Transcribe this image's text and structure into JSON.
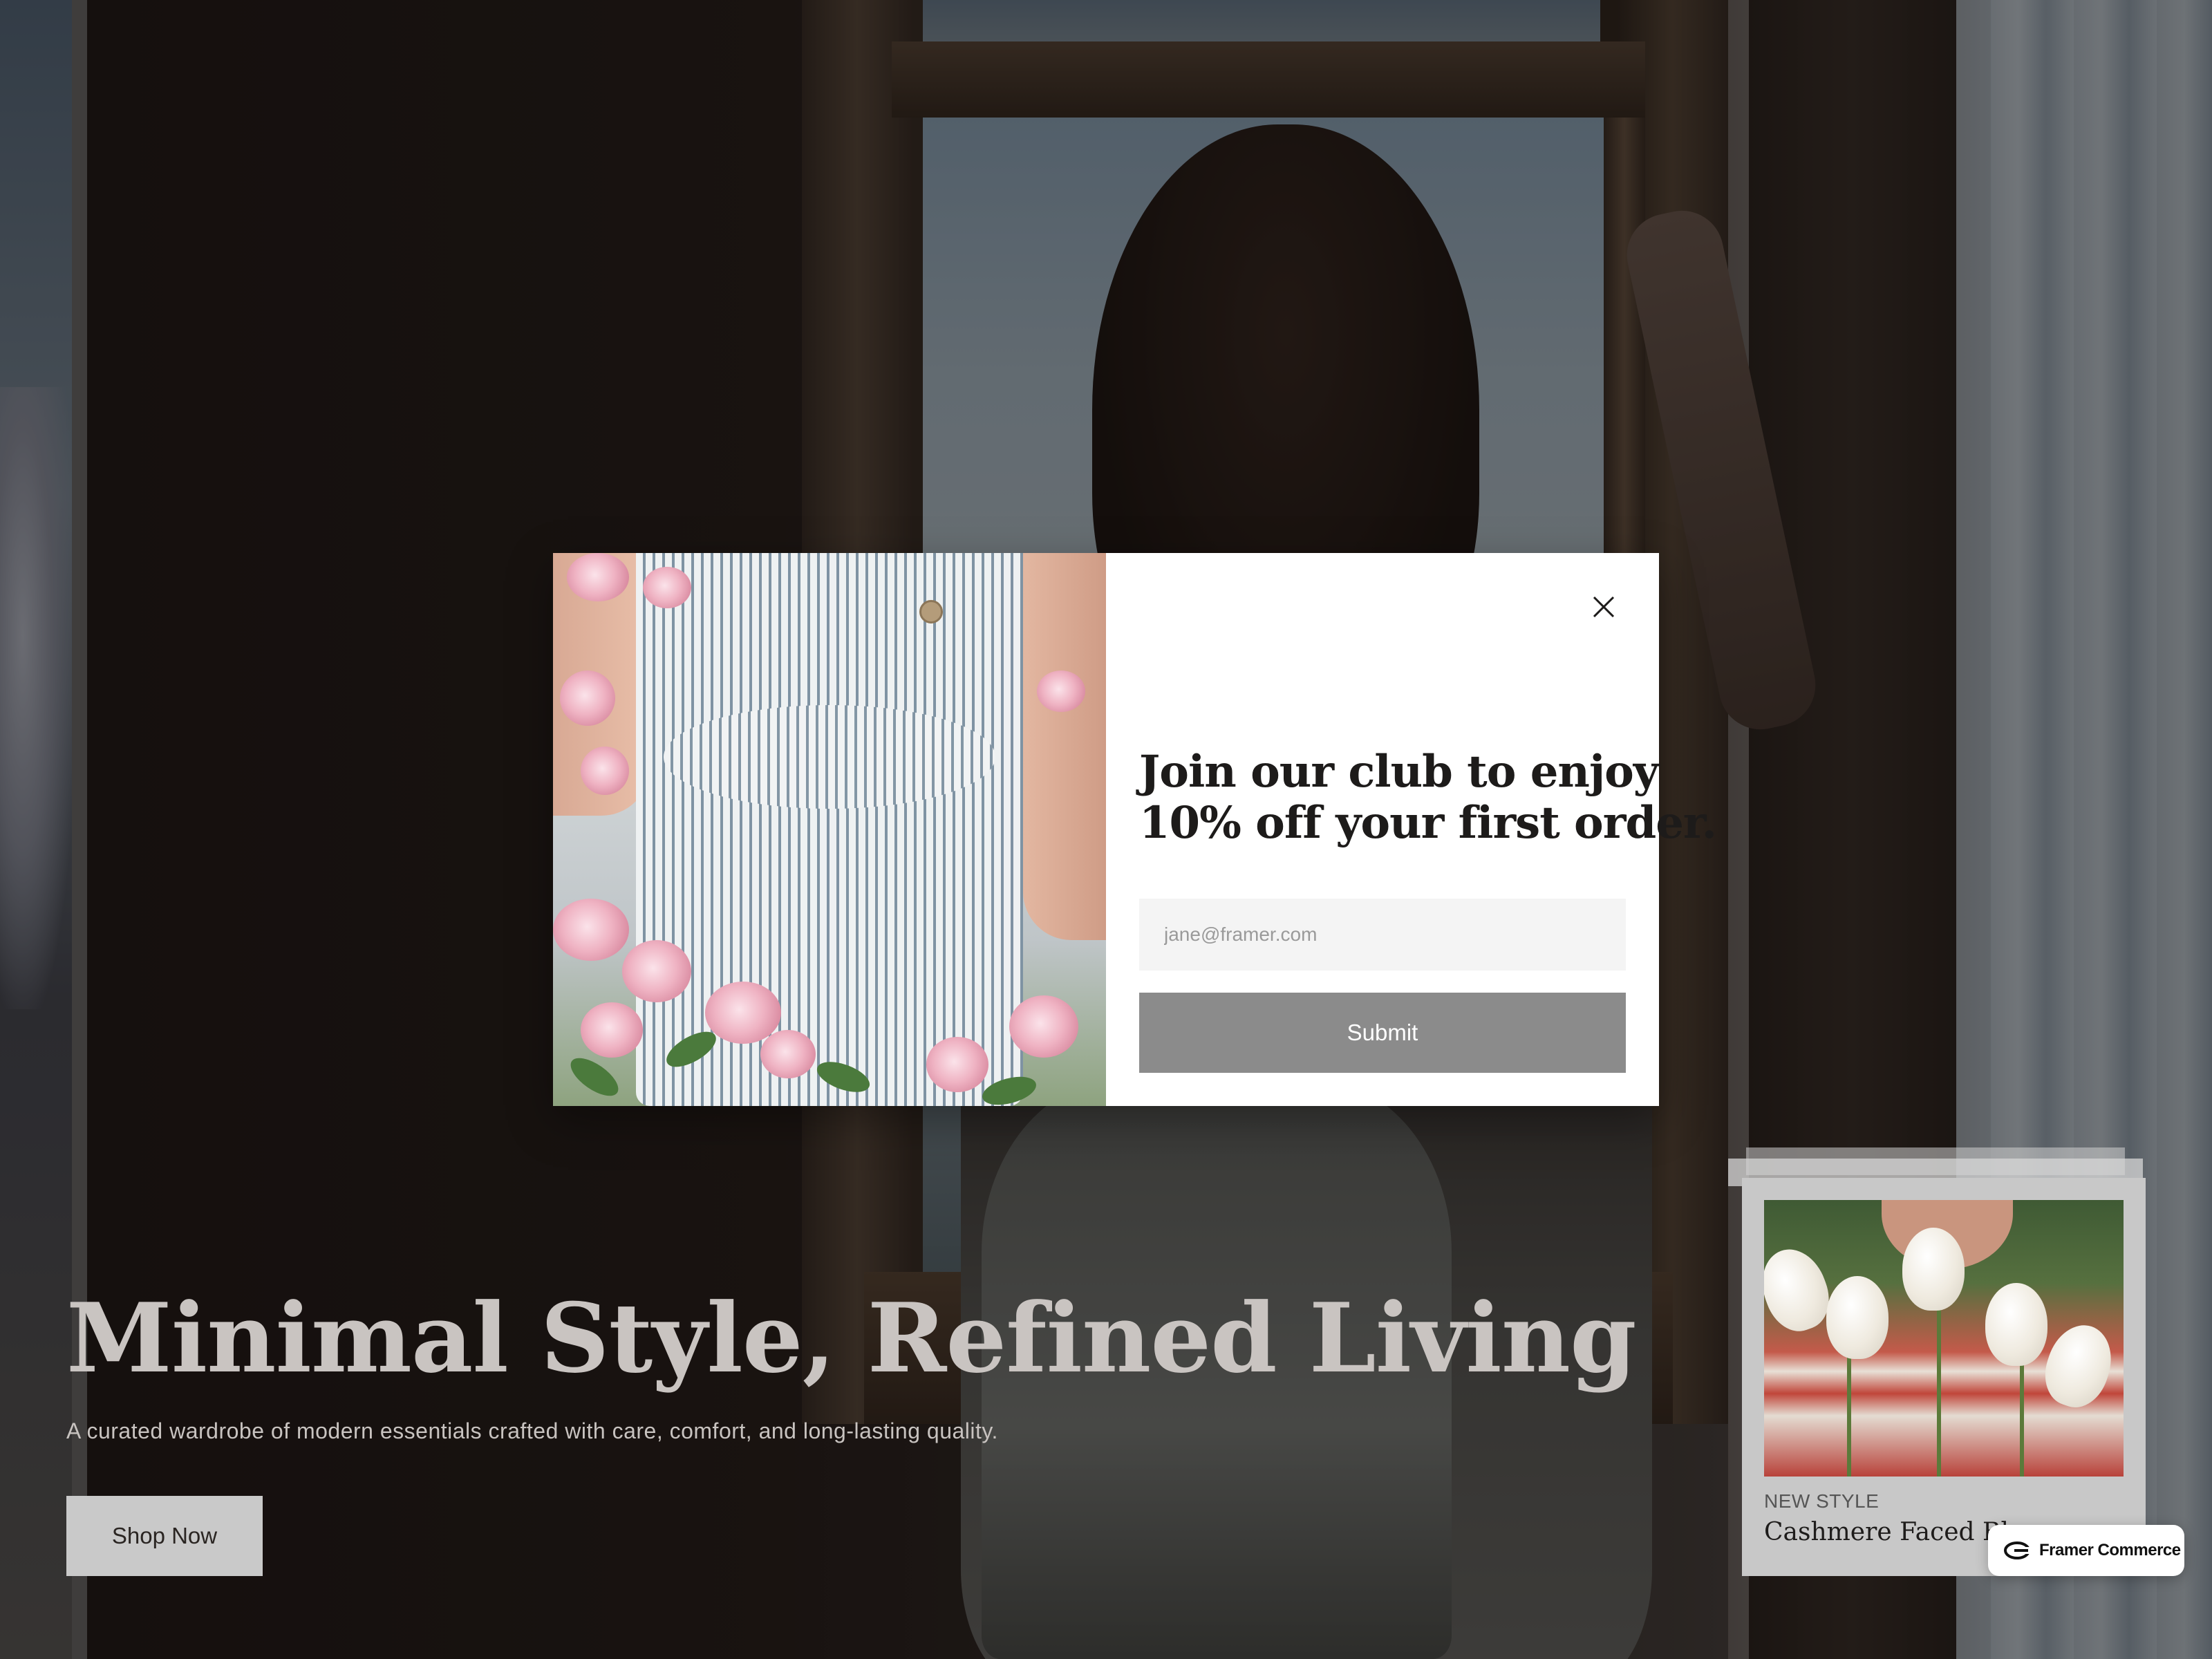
{
  "hero": {
    "title": "Minimal Style, Refined Living",
    "subtitle": "A curated wardrobe of modern essentials crafted with care, comfort, and long-lasting quality.",
    "cta_label": "Shop Now"
  },
  "product_card": {
    "tag": "NEW STYLE",
    "name": "Cashmere Faced  Bla"
  },
  "badge": {
    "label": "Framer Commerce",
    "icon": "framer-commerce-logo-icon"
  },
  "modal": {
    "title_line1": "Join our club to enjoy",
    "title_line2": "10% off your first order.",
    "email_placeholder": "jane@framer.com",
    "email_value": "",
    "submit_label": "Submit",
    "close_icon": "close-icon"
  },
  "colors": {
    "submit_bg": "#8b8b8b",
    "input_bg": "#f4f4f4",
    "shop_btn_bg": "#c9c9c9",
    "hero_text": "#c9c4c1"
  }
}
